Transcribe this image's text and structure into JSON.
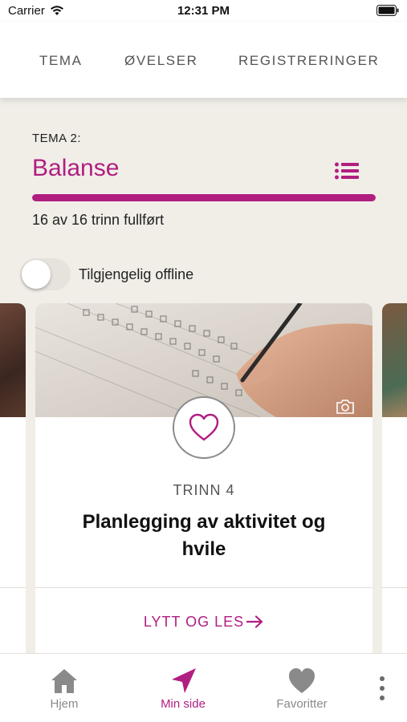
{
  "status_bar": {
    "carrier": "Carrier",
    "time": "12:31 PM"
  },
  "tabs": [
    {
      "label": "TEMA"
    },
    {
      "label": "ØVELSER"
    },
    {
      "label": "REGISTRERINGER"
    }
  ],
  "theme": {
    "label": "TEMA 2:",
    "title": "Balanse",
    "progress_fraction": 1.0,
    "progress_text": "16 av 16 trinn fullført"
  },
  "offline_toggle": {
    "label": "Tilgjengelig offline",
    "enabled": false
  },
  "card": {
    "step_label": "TRINN 4",
    "title": "Planlegging av aktivitet og hvile",
    "action_label": "LYTT OG LES"
  },
  "bottom_nav": [
    {
      "label": "Hjem",
      "icon": "home-icon"
    },
    {
      "label": "Min side",
      "icon": "navigation-arrow-icon",
      "active": true
    },
    {
      "label": "Favoritter",
      "icon": "heart-icon"
    }
  ],
  "colors": {
    "accent": "#b01e80",
    "background": "#f1eee8",
    "inactive": "#8a8a8a"
  }
}
